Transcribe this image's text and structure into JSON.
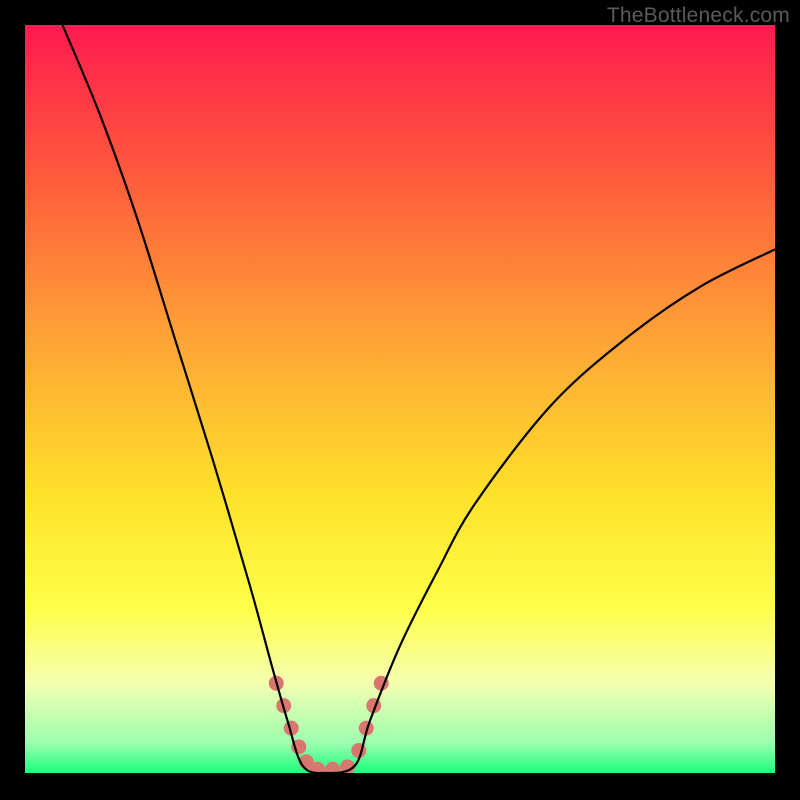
{
  "watermark": "TheBottleneck.com",
  "chart_data": {
    "type": "line",
    "title": "",
    "xlabel": "",
    "ylabel": "",
    "x_range": [
      0,
      100
    ],
    "y_range": [
      0,
      100
    ],
    "gradient_stops": [
      {
        "offset": 0,
        "color": "#ff1a4f"
      },
      {
        "offset": 20,
        "color": "#ff5a3c"
      },
      {
        "offset": 42,
        "color": "#ffa436"
      },
      {
        "offset": 63,
        "color": "#ffe22a"
      },
      {
        "offset": 78,
        "color": "#ffff4a"
      },
      {
        "offset": 88,
        "color": "#f4ffb0"
      },
      {
        "offset": 96,
        "color": "#9cffb0"
      },
      {
        "offset": 100,
        "color": "#1aff7a"
      }
    ],
    "curve": {
      "comment": "Main black V-curve. x in [0,100], y is bottleneck percent (0 = bottom/green, 100 = top/red). Minimum plateau ~0 around x=37..44.",
      "points": [
        {
          "x": 5,
          "y": 100
        },
        {
          "x": 10,
          "y": 88
        },
        {
          "x": 15,
          "y": 74
        },
        {
          "x": 20,
          "y": 58
        },
        {
          "x": 25,
          "y": 42
        },
        {
          "x": 30,
          "y": 25
        },
        {
          "x": 33,
          "y": 14
        },
        {
          "x": 35,
          "y": 7
        },
        {
          "x": 37,
          "y": 1
        },
        {
          "x": 40,
          "y": 0
        },
        {
          "x": 44,
          "y": 1
        },
        {
          "x": 46,
          "y": 7
        },
        {
          "x": 50,
          "y": 17
        },
        {
          "x": 55,
          "y": 27
        },
        {
          "x": 60,
          "y": 36
        },
        {
          "x": 70,
          "y": 49
        },
        {
          "x": 80,
          "y": 58
        },
        {
          "x": 90,
          "y": 65
        },
        {
          "x": 100,
          "y": 70
        }
      ]
    },
    "markers": {
      "comment": "Salmon-colored thick dots clustered near the minimum.",
      "color": "#d9766f",
      "points": [
        {
          "x": 33.5,
          "y": 12
        },
        {
          "x": 34.5,
          "y": 9
        },
        {
          "x": 35.5,
          "y": 6
        },
        {
          "x": 36.5,
          "y": 3.5
        },
        {
          "x": 37.5,
          "y": 1.5
        },
        {
          "x": 39,
          "y": 0.5
        },
        {
          "x": 41,
          "y": 0.5
        },
        {
          "x": 43,
          "y": 0.8
        },
        {
          "x": 44.5,
          "y": 3
        },
        {
          "x": 45.5,
          "y": 6
        },
        {
          "x": 46.5,
          "y": 9
        },
        {
          "x": 47.5,
          "y": 12
        }
      ]
    }
  }
}
